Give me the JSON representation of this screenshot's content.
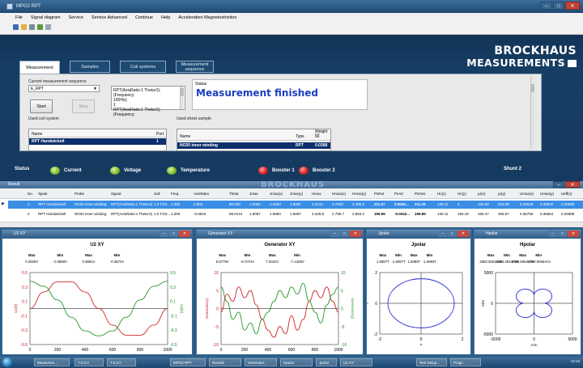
{
  "window": {
    "title": "MPG2 RPT"
  },
  "menu": [
    "File",
    "Signal diagram",
    "Service",
    "Service Advanced",
    "Continue",
    "Help",
    "Acceleration Magnetostriction"
  ],
  "brand": {
    "line1": "BROCKHAUS",
    "line2": "MEASUREMENTS"
  },
  "tabs": [
    "Measurement",
    "Samples",
    "Coil systems",
    "Measurement sequence"
  ],
  "measurement": {
    "sequence_label": "Current measurement sequence",
    "sequence_value": "E_RPT",
    "sequence_text": [
      "RPT(AxisRatio:1 Theta:0); (Frequency:",
      "100Hz);",
      "1",
      "RPT(AxisRatio:1 Theta:0); (Frequency:"
    ],
    "start": "Start",
    "stop": "Stop",
    "status_label": "Status",
    "status_text": "Measurement finished",
    "coil_label": "Used coil system",
    "coil_cols": [
      "Name",
      "Port"
    ],
    "coil_row": [
      "RPT Handwickelt",
      "1"
    ],
    "sample_label": "Used sheet sample",
    "sample_cols": [
      "Name",
      "Type",
      "Weight [g]"
    ],
    "sample_row": [
      "NO20 inner winding",
      "RPT",
      "0.0368"
    ]
  },
  "status_bar": {
    "title": "Status",
    "items": [
      "Current",
      "Voltage",
      "Temperature",
      "Booster 1",
      "Booster 2"
    ],
    "shunt": "Shunt 2",
    "colors": {
      "ok": "#7db628",
      "err": "#d31a1a"
    }
  },
  "table": {
    "title": "Result",
    "watermark": "BROCKHAUS",
    "columns": [
      "No.",
      "Spule",
      "Probe",
      "Signal",
      "Soll",
      "Freq.",
      "AxisRatio",
      "Theta",
      "Jmax",
      "Jmax(x)",
      "Jmax(y)",
      "Hmax",
      "Hmax(x)",
      "Hmax(y)",
      "PsRot",
      "PsAC",
      "PsGes",
      "Hc(x)",
      "Hc(y)",
      "μr(x)",
      "μr(y)",
      "Umax(x)",
      "Umax(y)",
      "Ueff(x)"
    ],
    "rows": [
      [
        "1",
        "RPT Handwickelt",
        "NO20 inner winding",
        "RPT(AxisRatio:1 Theta:0)",
        "1.0 T/10...",
        "1.000",
        "0.904",
        "90.000",
        "1.6084",
        "1.5983",
        "1.6087",
        "3.3143",
        "3.7603",
        "2.485.0",
        "211.27",
        "0.0042...",
        "211.29",
        "130.11",
        "0",
        "455.89",
        "519.09",
        "0.36649",
        "0.36500",
        "0.25888"
      ],
      [
        "2",
        "RPT Handwickelt",
        "NO20 inner winding",
        "RPT(AxisRatio:1 Theta:0)",
        "1.0 T/10...",
        "1.000",
        "-0.9916",
        "89.0144",
        "1.6087",
        "1.5983",
        "1.6087",
        "3.428.8",
        "2.790.7",
        "2.583.2",
        "199.96",
        "-0.0042...",
        "199.89",
        "130.11",
        "150.19",
        "455.47",
        "496.57",
        "0.36793",
        "0.36664",
        "0.25989"
      ]
    ]
  },
  "plots": [
    {
      "window_title": "U2 XY",
      "chart_data": {
        "type": "line",
        "title": "U2 XY",
        "stats": {
          "headers": [
            "Max",
            "Min",
            "Max",
            "Min"
          ],
          "values": [
            "0.3828V",
            "-0.3869V",
            "0.3881V",
            "-0.3872V"
          ]
        },
        "xlim": [
          0,
          1000
        ],
        "xticks": [
          0,
          200,
          400,
          600,
          800,
          1000
        ],
        "ylim": [
          -0.5,
          0.5
        ],
        "yticks": [
          "0.5",
          "0.3",
          "0.1",
          "-0.1",
          "-0.3",
          "-0.5"
        ],
        "y2ticks": [
          "0.5",
          "0.3",
          "0.1",
          "-0.1",
          "-0.3",
          "-0.5"
        ],
        "ylabel": "Ux[V]",
        "y2label": "Uy[V]",
        "series": [
          {
            "color": "#d02a2a",
            "x": [
              0,
              100,
              200,
              300,
              400,
              500,
              600,
              700,
              800,
              900,
              1000
            ],
            "y": [
              0.0,
              0.23,
              0.37,
              0.37,
              0.23,
              0.0,
              -0.23,
              -0.37,
              -0.37,
              -0.23,
              0.0
            ]
          },
          {
            "color": "#2a9a2a",
            "x": [
              0,
              100,
              200,
              300,
              400,
              500,
              600,
              700,
              800,
              900,
              1000
            ],
            "y": [
              0.38,
              0.31,
              0.12,
              -0.12,
              -0.31,
              -0.38,
              -0.31,
              -0.12,
              0.12,
              0.31,
              0.38
            ]
          }
        ]
      }
    },
    {
      "window_title": "Generator XY",
      "chart_data": {
        "type": "line",
        "title": "Generator XY",
        "stats": {
          "headers": [
            "Max",
            "Min",
            "Max",
            "Min"
          ],
          "values": [
            "6.5779V",
            "-8.7074V",
            "7.2022V",
            "-7.1325V"
          ]
        },
        "xlim": [
          0,
          1000
        ],
        "xticks": [
          0,
          200,
          400,
          600,
          800,
          1000
        ],
        "ylim": [
          -10,
          10
        ],
        "yticks": [
          "10",
          "5",
          "0",
          "-5",
          "-10"
        ],
        "y2ticks": [
          "10",
          "5",
          "0",
          "-5",
          "-10"
        ],
        "ylabel": "Generator(x)",
        "y2label": "Generator(y)",
        "series": [
          {
            "color": "#d02a2a",
            "x": [
              0,
              50,
              100,
              150,
              200,
              250,
              300,
              350,
              400,
              450,
              500,
              550,
              600,
              650,
              700,
              750,
              800,
              850,
              900,
              950,
              1000
            ],
            "y": [
              -1,
              4,
              2,
              6,
              3,
              5,
              1,
              -3,
              -6,
              -8,
              -5,
              -7,
              -2,
              -6,
              -3,
              2,
              5,
              3,
              6,
              2,
              -1
            ]
          },
          {
            "color": "#2a9a2a",
            "x": [
              0,
              50,
              100,
              150,
              200,
              250,
              300,
              350,
              400,
              450,
              500,
              550,
              600,
              650,
              700,
              750,
              800,
              850,
              900,
              950,
              1000
            ],
            "y": [
              6,
              2,
              -3,
              -1,
              -6,
              -4,
              -7,
              -3,
              -1,
              2,
              5,
              3,
              6,
              4,
              7,
              2,
              -1,
              -4,
              1,
              4,
              6
            ]
          }
        ]
      }
    },
    {
      "window_title": "Jpolar",
      "chart_data": {
        "type": "scatter",
        "title": "Jpolar",
        "stats": {
          "headers": [
            "Max",
            "Min",
            "Max",
            "Min"
          ],
          "values": [
            "1.6087T",
            "-1.6087T",
            "1.5983T",
            "-1.5983T"
          ]
        },
        "xlim": [
          -2,
          2
        ],
        "ylim": [
          -2,
          2
        ],
        "xticks": [
          "-2",
          "0",
          "2"
        ],
        "yticks": [
          "2",
          "0",
          "-2"
        ],
        "xlabel": "T",
        "ylabel": "T",
        "series": [
          {
            "color": "#2b2bd0",
            "shape": "circle",
            "radius_x": 1.6087,
            "radius_y": 1.5983
          }
        ]
      }
    },
    {
      "window_title": "Hpolar",
      "chart_data": {
        "type": "scatter",
        "title": "Hpolar",
        "stats": {
          "headers": [
            "Max",
            "Min",
            "Max",
            "Min"
          ],
          "values": [
            "2582.5024A/m",
            "-2583.3844A/m",
            "2790.6054A/m",
            "-2790.5066A/m"
          ]
        },
        "xlim": [
          -5000,
          5000
        ],
        "ylim": [
          -5000,
          5000
        ],
        "xticks": [
          "-5000",
          "0",
          "5000"
        ],
        "yticks": [
          "5000",
          "0",
          "-5000"
        ],
        "xlabel": "A/m",
        "ylabel": "A/m",
        "series": [
          {
            "color": "#2b2bd0",
            "shape": "clover",
            "radius_max": 2790.6,
            "radius_min": 1400
          }
        ]
      }
    }
  ],
  "taskbar": {
    "tasks": [
      "Measurem...",
      "7.0.0.0",
      "7.5.0.0",
      "MPG2 RPT",
      "Results",
      "Generator...",
      "Hpolar",
      "Jpolar",
      "U2 XY",
      "Test Setup...",
      "Progr..."
    ],
    "clock": "13:16"
  }
}
